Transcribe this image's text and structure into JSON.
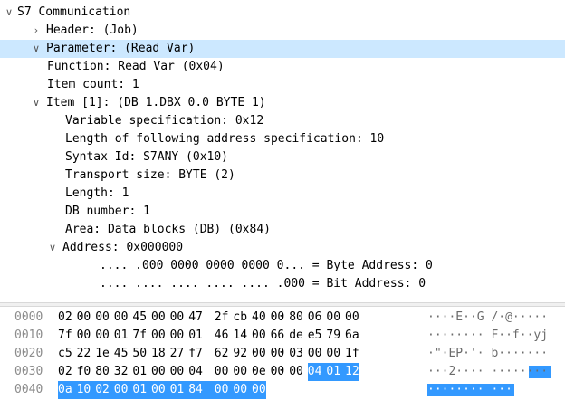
{
  "tree": [
    {
      "text": "S7 Communication",
      "level": 0,
      "expander": "down"
    },
    {
      "text": "Header: (Job)",
      "level": 1,
      "expander": "right"
    },
    {
      "text": "Parameter: (Read Var)",
      "level": 1,
      "expander": "down",
      "selected": true
    },
    {
      "text": "Function: Read Var (0x04)",
      "level": 2
    },
    {
      "text": "Item count: 1",
      "level": 2
    },
    {
      "text": "Item [1]: (DB 1.DBX 0.0 BYTE 1)",
      "level": 2,
      "expander": "down"
    },
    {
      "text": "Variable specification: 0x12",
      "level": 3
    },
    {
      "text": "Length of following address specification: 10",
      "level": 3
    },
    {
      "text": "Syntax Id: S7ANY (0x10)",
      "level": 3
    },
    {
      "text": "Transport size: BYTE (2)",
      "level": 3
    },
    {
      "text": "Length: 1",
      "level": 3
    },
    {
      "text": "DB number: 1",
      "level": 3
    },
    {
      "text": "Area: Data blocks (DB) (0x84)",
      "level": 3
    },
    {
      "text": "Address: 0x000000",
      "level": 3,
      "expander": "down"
    },
    {
      "text": ".... .000 0000 0000 0000 0... = Byte Address: 0",
      "level": 4
    },
    {
      "text": ".... .... .... .... .... .000 = Bit Address: 0",
      "level": 4
    }
  ],
  "hex": [
    {
      "offset": "0000",
      "bytes": [
        "02",
        "00",
        "00",
        "00",
        "45",
        "00",
        "00",
        "47",
        "2f",
        "cb",
        "40",
        "00",
        "80",
        "06",
        "00",
        "00"
      ],
      "ascii": "····E··G /·@·····"
    },
    {
      "offset": "0010",
      "bytes": [
        "7f",
        "00",
        "00",
        "01",
        "7f",
        "00",
        "00",
        "01",
        "46",
        "14",
        "00",
        "66",
        "de",
        "e5",
        "79",
        "6a"
      ],
      "ascii": "········ F··f··yj"
    },
    {
      "offset": "0020",
      "bytes": [
        "c5",
        "22",
        "1e",
        "45",
        "50",
        "18",
        "27",
        "f7",
        "62",
        "92",
        "00",
        "00",
        "03",
        "00",
        "00",
        "1f"
      ],
      "ascii": "·\"·EP·'· b·······"
    },
    {
      "offset": "0030",
      "bytes": [
        "02",
        "f0",
        "80",
        "32",
        "01",
        "00",
        "00",
        "04",
        "00",
        "00",
        "0e",
        "00",
        "00",
        "04",
        "01",
        "12"
      ],
      "ascii": "···2···· ········"
    },
    {
      "offset": "0040",
      "bytes": [
        "0a",
        "10",
        "02",
        "00",
        "01",
        "00",
        "01",
        "84",
        "00",
        "00",
        "00"
      ],
      "ascii": "········ ···"
    }
  ],
  "highlight": {
    "start": 61,
    "end": 74
  },
  "colors": {
    "selected_row": "#cce8ff",
    "hex_highlight": "#3399ff",
    "offset_text": "#8c8c8c"
  }
}
